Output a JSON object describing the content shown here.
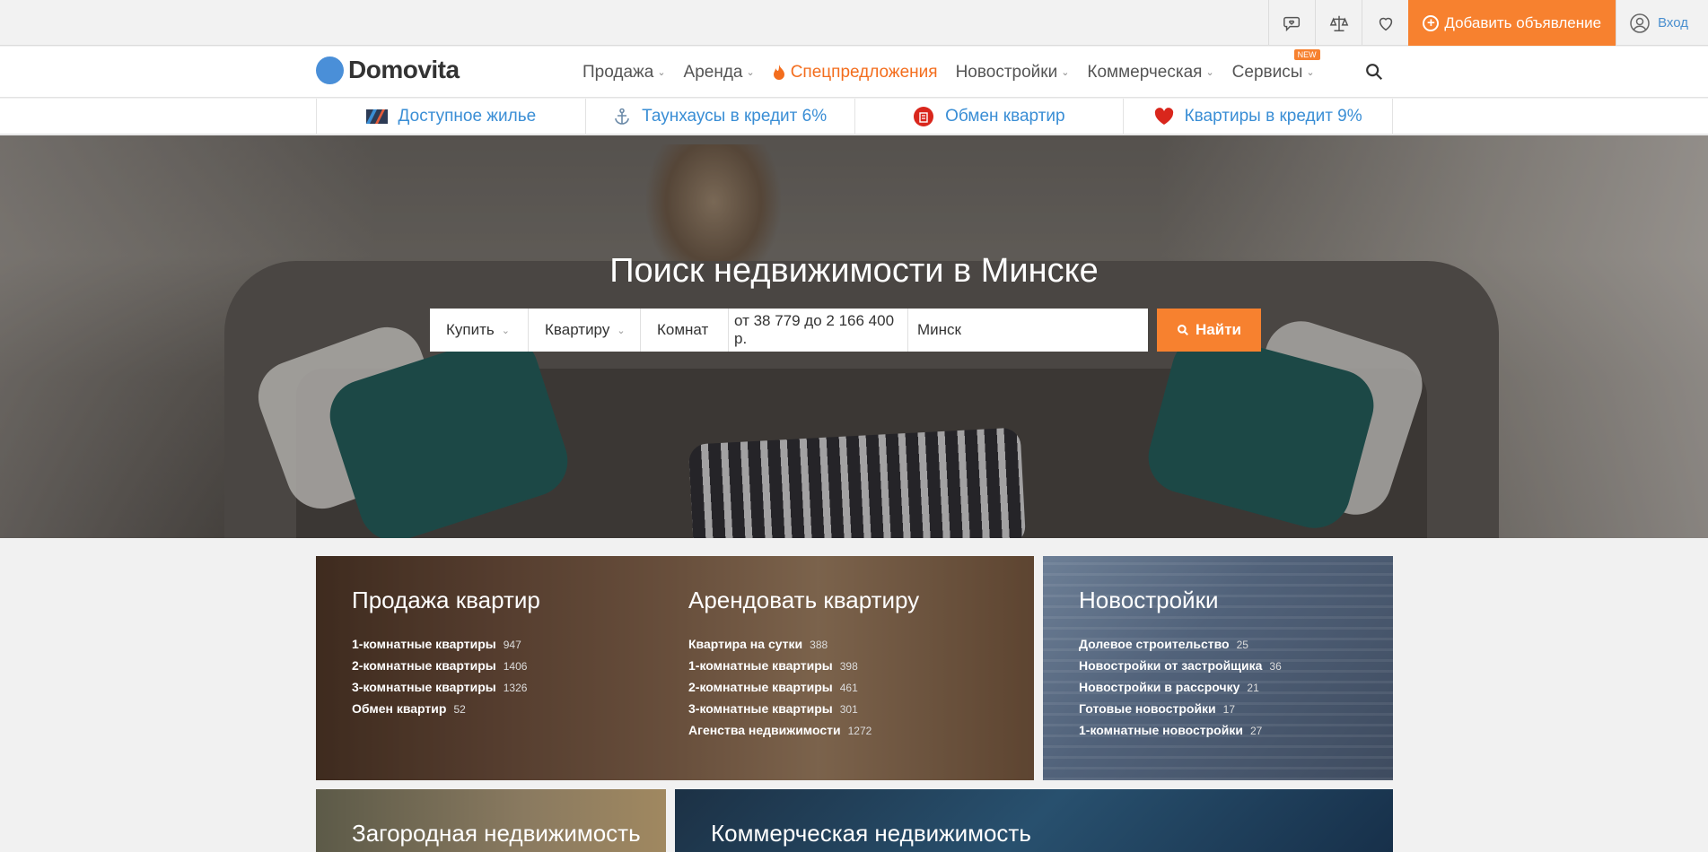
{
  "topbar": {
    "icons": [
      "chat-heart-icon",
      "compare-scales-icon",
      "favorite-heart-icon"
    ],
    "add_ad_label": "Добавить объявление",
    "login_label": "Вход"
  },
  "nav": {
    "logo_text": "Domovita",
    "items": [
      {
        "label": "Продажа"
      },
      {
        "label": "Аренда"
      },
      {
        "label": "Спецпредложения"
      },
      {
        "label": "Новостройки"
      },
      {
        "label": "Коммерческая"
      },
      {
        "label": "Сервисы"
      }
    ],
    "new_badge": "NEW",
    "accent_color": "#f7812f"
  },
  "promos": [
    {
      "label": "Доступное жилье",
      "icon": "house-stripes-icon"
    },
    {
      "label": "Таунхаусы в кредит 6%",
      "icon": "anchor-icon"
    },
    {
      "label": "Обмен квартир",
      "icon": "exchange-building-icon"
    },
    {
      "label": "Квартиры в кредит 9%",
      "icon": "red-heart-icon"
    }
  ],
  "hero": {
    "title": "Поиск недвижимости в Минске",
    "search": {
      "deal_type": "Купить",
      "property_type": "Квартиру",
      "rooms": "Комнат",
      "price": "от 38 779 до 2 166 400 р.",
      "city": "Минск",
      "submit_label": "Найти"
    }
  },
  "tiles": {
    "sale": {
      "title": "Продажа квартир",
      "links": [
        {
          "label": "1-комнатные квартиры",
          "count": "947"
        },
        {
          "label": "2-комнатные квартиры",
          "count": "1406"
        },
        {
          "label": "3-комнатные квартиры",
          "count": "1326"
        },
        {
          "label": "Обмен квартир",
          "count": "52"
        }
      ]
    },
    "rent": {
      "title": "Арендовать квартиру",
      "links": [
        {
          "label": "Квартира на сутки",
          "count": "388"
        },
        {
          "label": "1-комнатные квартиры",
          "count": "398"
        },
        {
          "label": "2-комнатные квартиры",
          "count": "461"
        },
        {
          "label": "3-комнатные квартиры",
          "count": "301"
        },
        {
          "label": "Агенства недвижимости",
          "count": "1272"
        }
      ]
    },
    "new": {
      "title": "Новостройки",
      "links": [
        {
          "label": "Долевое строительство",
          "count": "25"
        },
        {
          "label": "Новостройки от застройщика",
          "count": "36"
        },
        {
          "label": "Новостройки в рассрочку",
          "count": "21"
        },
        {
          "label": "Готовые новостройки",
          "count": "17"
        },
        {
          "label": "1-комнатные новостройки",
          "count": "27"
        }
      ]
    },
    "country": {
      "title": "Загородная недвижимость"
    },
    "commercial": {
      "title": "Коммерческая недвижимость"
    }
  }
}
